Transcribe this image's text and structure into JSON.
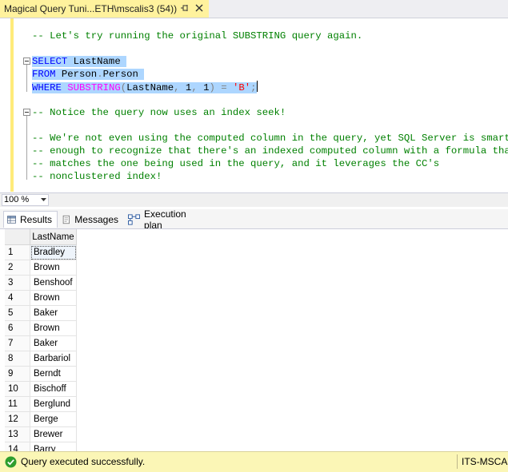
{
  "tab": {
    "title": "Magical Query Tuni...ETH\\mscalis3 (54))",
    "pin_glyph": "⊣",
    "close_glyph": "✕"
  },
  "editor": {
    "comment1": "-- Let's try running the original SUBSTRING query again.",
    "select_kw": "SELECT",
    "select_col": " LastName",
    "from_kw": "FROM",
    "from_schema": " Person",
    "from_dot": ".",
    "from_table": "Person",
    "where_kw": "WHERE",
    "where_fn": "SUBSTRING",
    "where_open": "(",
    "where_col": "LastName",
    "where_comma1": ",",
    "where_arg1": " 1",
    "where_comma2": ",",
    "where_arg2": " 1",
    "where_close": ")",
    "where_eq": "=",
    "where_str": "'B'",
    "where_semi": ";",
    "comment2": "-- Notice the query now uses an index seek!",
    "comment3": "-- We're not even using the computed column in the query, yet SQL Server is smart",
    "comment4": "-- enough to recognize that there's an indexed computed column with a formula that",
    "comment5": "-- matches the one being used in the query, and it leverages the CC's",
    "comment6": "-- nonclustered index!"
  },
  "zoom": {
    "value": "100 %"
  },
  "result_tabs": [
    {
      "label": "Results",
      "icon": "grid-icon"
    },
    {
      "label": "Messages",
      "icon": "messages-icon"
    },
    {
      "label": "Execution plan",
      "icon": "execution-plan-icon"
    }
  ],
  "grid": {
    "column_header": "LastName",
    "rows": [
      {
        "n": "1",
        "v": "Bradley"
      },
      {
        "n": "2",
        "v": "Brown"
      },
      {
        "n": "3",
        "v": "Benshoof"
      },
      {
        "n": "4",
        "v": "Brown"
      },
      {
        "n": "5",
        "v": "Baker"
      },
      {
        "n": "6",
        "v": "Brown"
      },
      {
        "n": "7",
        "v": "Baker"
      },
      {
        "n": "8",
        "v": "Barbariol"
      },
      {
        "n": "9",
        "v": "Berndt"
      },
      {
        "n": "10",
        "v": "Bischoff"
      },
      {
        "n": "11",
        "v": "Berglund"
      },
      {
        "n": "12",
        "v": "Berge"
      },
      {
        "n": "13",
        "v": "Brewer"
      },
      {
        "n": "14",
        "v": "Barry"
      }
    ]
  },
  "status": {
    "message": "Query executed successfully.",
    "server": "ITS-MSCAL",
    "icon": "success-check-icon",
    "colors": {
      "bar": "#fbf6b6",
      "check": "#2e9e2e"
    }
  }
}
